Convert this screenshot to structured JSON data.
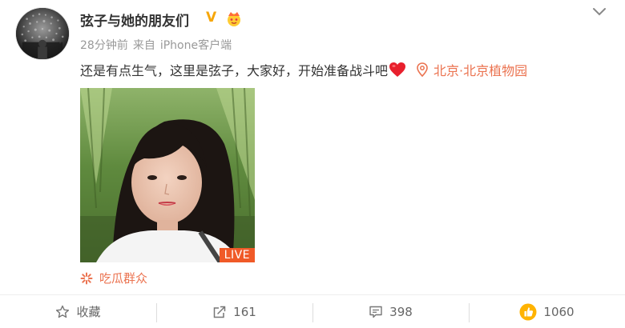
{
  "post": {
    "username": "弦子与她的朋友们",
    "verified_badge": "V",
    "time": "28分钟前",
    "from_label": "来自",
    "client": "iPhone客户端",
    "text": "还是有点生气，这里是弦子，大家好，开始准备战斗吧",
    "location": "北京·北京植物园",
    "live_badge": "LIVE",
    "topic": "吃瓜群众",
    "accent_color": "#eb7350",
    "verified_color": "#f6a609"
  },
  "toolbar": {
    "favorite_label": "收藏",
    "repost_count": "161",
    "comment_count": "398",
    "like_count": "1060"
  },
  "icons": {
    "avatar": "avatar-image",
    "crown": "crown-emoji-icon",
    "chevron": "chevron-down-icon",
    "heart": "red-heart-emoji-icon",
    "location": "location-pin-icon",
    "topic": "topic-spark-icon",
    "favorite": "star-icon",
    "repost": "repost-icon",
    "comment": "comment-icon",
    "like": "thumbs-up-icon"
  }
}
